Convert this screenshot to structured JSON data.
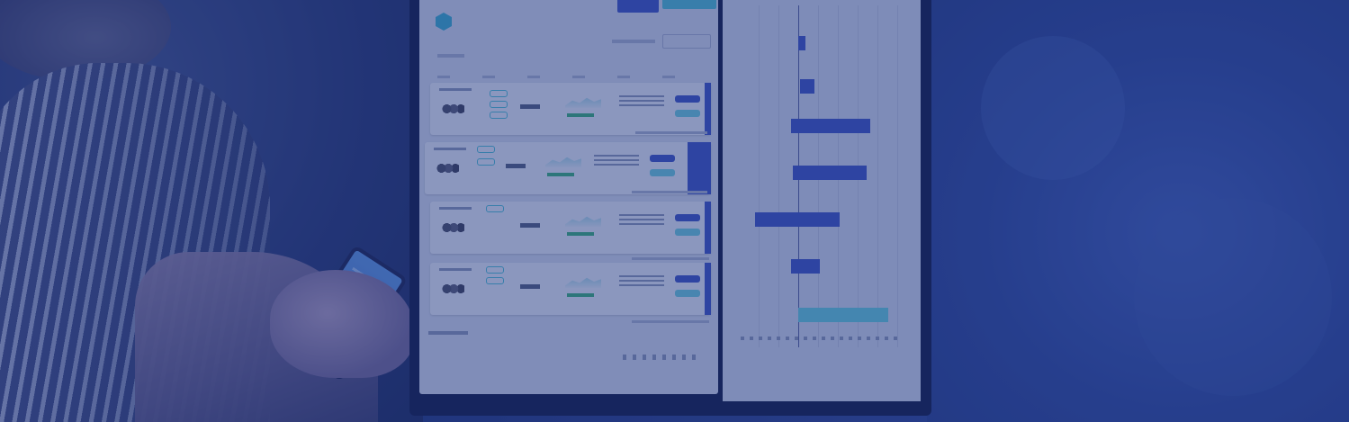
{
  "photo": {
    "subject": "",
    "overlay_color": "#1e3480"
  },
  "colors": {
    "accent": "#3d55c4",
    "teal": "#4fc2d6",
    "screen": "#d6ddef"
  },
  "chart_data": {
    "type": "bar",
    "orientation": "horizontal",
    "title": "",
    "xlabel": "",
    "ylabel": "",
    "categories": [],
    "series": [],
    "grid": true
  }
}
